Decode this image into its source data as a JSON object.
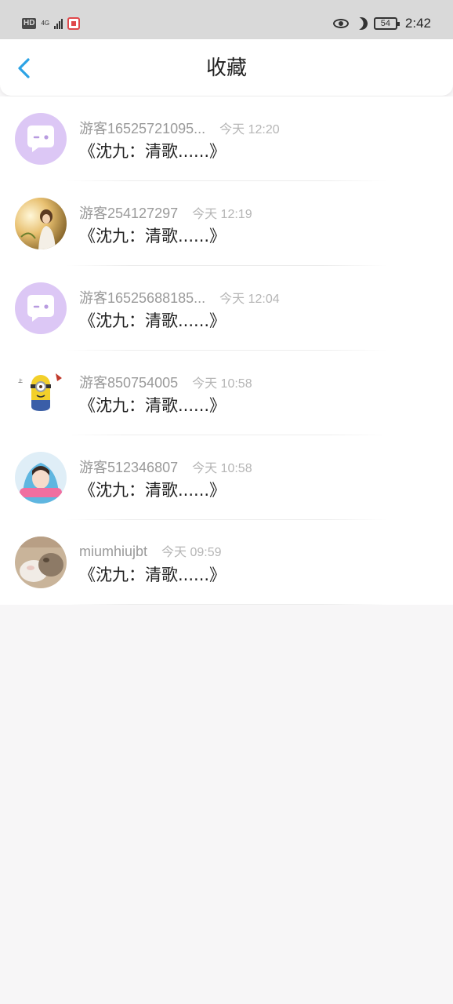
{
  "status_bar": {
    "left_badge": "HD",
    "network": "4G",
    "battery": "54",
    "time": "2:42"
  },
  "header": {
    "title": "收藏",
    "back_icon": "chevron-left-icon"
  },
  "colors": {
    "accent": "#2ca3e5",
    "default_avatar_bg": "#dcc7f5",
    "default_avatar_icon": "#ffffff"
  },
  "favorites": [
    {
      "name": "游客16525721095...",
      "time": "今天 12:20",
      "content": "《沈九：清歌......》",
      "avatar": "default-chat-avatar"
    },
    {
      "name": "游客254127297",
      "time": "今天 12:19",
      "content": "《沈九：清歌......》",
      "avatar": "photo-girl-sunlight-avatar"
    },
    {
      "name": "游客16525688185...",
      "time": "今天 12:04",
      "content": "《沈九：清歌......》",
      "avatar": "default-chat-avatar"
    },
    {
      "name": "游客850754005",
      "time": "今天 10:58",
      "content": "《沈九：清歌......》",
      "avatar": "minion-avatar"
    },
    {
      "name": "游客512346807",
      "time": "今天 10:58",
      "content": "《沈九：清歌......》",
      "avatar": "photo-girl-hood-avatar"
    },
    {
      "name": "miumhiujbt",
      "time": "今天 09:59",
      "content": "《沈九：清歌......》",
      "avatar": "photo-cat-avatar"
    }
  ]
}
